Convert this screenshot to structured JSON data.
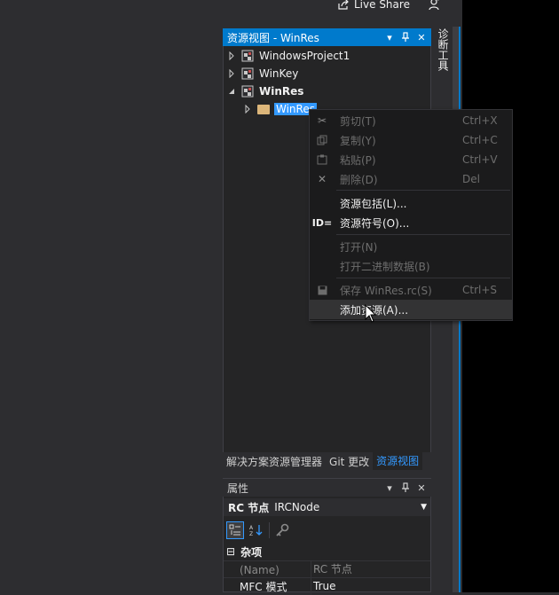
{
  "top": {
    "live_share": "Live Share"
  },
  "diag_tab": {
    "label": "诊断工具"
  },
  "resource_view": {
    "title": "资源视图 - WinRes",
    "tree": [
      {
        "label": "WindowsProject1",
        "bold": false
      },
      {
        "label": "WinKey",
        "bold": false
      },
      {
        "label": "WinRes",
        "bold": true
      },
      {
        "label": "WinRes",
        "selected": true
      }
    ],
    "bottom_tabs": [
      "解决方案资源管理器",
      "Git 更改",
      "资源视图"
    ]
  },
  "context_menu": {
    "items": [
      {
        "label": "剪切(T)",
        "shortcut": "Ctrl+X",
        "icon": "scissors-icon",
        "disabled": true
      },
      {
        "label": "复制(Y)",
        "shortcut": "Ctrl+C",
        "icon": "copy-icon",
        "disabled": true
      },
      {
        "label": "粘贴(P)",
        "shortcut": "Ctrl+V",
        "icon": "paste-icon",
        "disabled": true
      },
      {
        "label": "删除(D)",
        "shortcut": "Del",
        "icon": "delete-icon",
        "disabled": true
      },
      {
        "label": "资源包括(L)...",
        "shortcut": "",
        "icon": "",
        "disabled": false
      },
      {
        "label": "资源符号(O)...",
        "shortcut": "",
        "icon": "id-icon",
        "icon_text": "ID=",
        "disabled": false
      },
      {
        "label": "打开(N)",
        "shortcut": "",
        "icon": "",
        "disabled": true
      },
      {
        "label": "打开二进制数据(B)",
        "shortcut": "",
        "icon": "",
        "disabled": true
      },
      {
        "label": "保存 WinRes.rc(S)",
        "shortcut": "Ctrl+S",
        "icon": "save-icon",
        "disabled": true
      },
      {
        "label": "添加资源(A)...",
        "shortcut": "",
        "icon": "",
        "disabled": false,
        "hovered": true
      }
    ]
  },
  "properties": {
    "title": "属性",
    "object_bold": "RC 节点",
    "object_type": "IRCNode",
    "category": "杂项",
    "rows": [
      {
        "name": "(Name)",
        "value": "RC 节点",
        "dim": true
      },
      {
        "name": "MFC 模式",
        "value": "True",
        "dim": false
      }
    ]
  },
  "colors": {
    "accent": "#007acc",
    "selection": "#3399ff",
    "background": "#2d2d30",
    "folder": "#dcb67a"
  }
}
